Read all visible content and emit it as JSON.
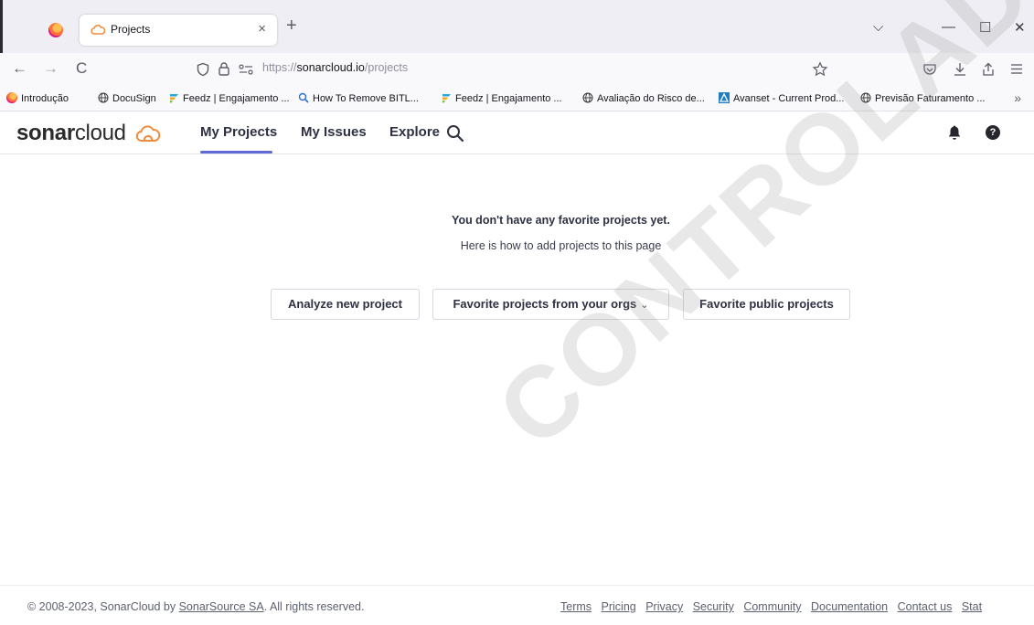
{
  "browser": {
    "tab_title": "Projects",
    "tab_close": "×",
    "new_tab": "+",
    "window_controls": {
      "list": "⌵",
      "minimize": "—",
      "maximize": "☐",
      "close": "✕"
    },
    "nav": {
      "back": "←",
      "forward": "→",
      "reload": "C"
    },
    "url_prefix": "https://",
    "url_host": "sonarcloud.io",
    "url_path": "/projects",
    "bookmarks": [
      {
        "label": "Introdução",
        "icon": "firefox-icon"
      },
      {
        "label": "DocuSign",
        "icon": "globe-icon"
      },
      {
        "label": "Feedz | Engajamento ...",
        "icon": "feedz-icon"
      },
      {
        "label": "How To Remove BITL...",
        "icon": "search-icon"
      },
      {
        "label": "Feedz | Engajamento ...",
        "icon": "feedz-icon"
      },
      {
        "label": "Avaliação do Risco de...",
        "icon": "globe-icon"
      },
      {
        "label": "Avanset - Current Prod...",
        "icon": "avanset-icon"
      },
      {
        "label": "Previsão Faturamento ...",
        "icon": "globe-icon"
      }
    ],
    "bookmarks_more": "»"
  },
  "app": {
    "logo_bold": "sonar",
    "logo_regular": "cloud",
    "nav": {
      "my_projects": "My Projects",
      "my_issues": "My Issues",
      "explore": "Explore"
    }
  },
  "main": {
    "empty_title": "You don't have any favorite projects yet.",
    "empty_subtitle": "Here is how to add projects to this page",
    "buttons": {
      "analyze": "Analyze new project",
      "favorite_orgs": "Favorite projects from your orgs",
      "favorite_public": "Favorite public projects"
    }
  },
  "footer": {
    "copyright_prefix": "© 2008-2023, SonarCloud by ",
    "copyright_link": "SonarSource SA",
    "copyright_suffix": ". All rights reserved.",
    "links": [
      "Terms",
      "Pricing",
      "Privacy",
      "Security",
      "Community",
      "Documentation",
      "Contact us",
      "Stat"
    ]
  },
  "watermark": "CONTROLADA",
  "colors": {
    "accent_underline": "#5f6ad6",
    "logo_cloud": "#f18b3b",
    "text_dark": "#2e3142"
  }
}
